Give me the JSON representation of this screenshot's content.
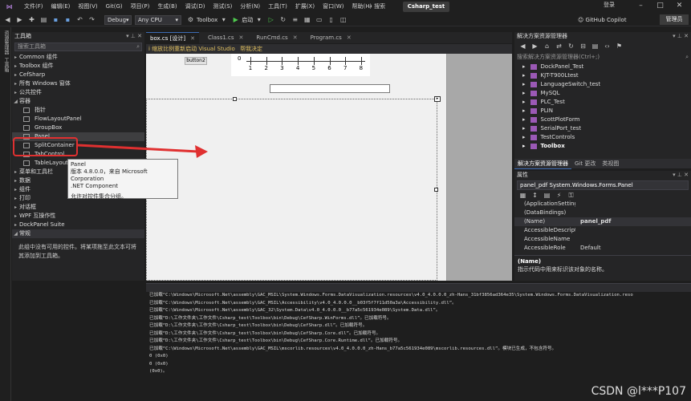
{
  "menu": {
    "items": [
      "文件(F)",
      "编辑(E)",
      "视图(V)",
      "Git(G)",
      "项目(P)",
      "生成(B)",
      "调试(D)",
      "测试(S)",
      "分析(N)",
      "工具(T)",
      "扩展(X)",
      "窗口(W)",
      "帮助(H)"
    ],
    "search_label": "搜索",
    "project_name": "Csharp_test",
    "login_label": "登录"
  },
  "toolbar": {
    "config": "Debug",
    "platform": "Any CPU",
    "toolbox_label": "Toolbox",
    "start_label": "启动",
    "copilot_label": "GitHub Copilot",
    "admin_label": "管理员"
  },
  "left_strip": {
    "tab1": "资源管理器",
    "tab2": "工具箱"
  },
  "toolbox": {
    "title": "工具箱",
    "search_placeholder": "搜索工具箱",
    "items": [
      {
        "label": "Common 组件",
        "arrow": "▸"
      },
      {
        "label": "Toolbox 组件",
        "arrow": "▸"
      },
      {
        "label": "CefSharp",
        "arrow": "▸"
      },
      {
        "label": "所有 Windows 窗体",
        "arrow": "▸"
      },
      {
        "label": "公共控件",
        "arrow": "▸"
      },
      {
        "label": "容器",
        "arrow": "◢"
      }
    ],
    "container_items": [
      "指针",
      "FlowLayoutPanel",
      "GroupBox",
      "Panel",
      "SplitContainer",
      "TabControl",
      "TableLayoutPanel"
    ],
    "items_after": [
      {
        "label": "菜单和工具栏",
        "arrow": "▸"
      },
      {
        "label": "数据",
        "arrow": "▸"
      },
      {
        "label": "组件",
        "arrow": "▸"
      },
      {
        "label": "打印",
        "arrow": "▸"
      },
      {
        "label": "对话框",
        "arrow": "▸"
      },
      {
        "label": "WPF 互操作性",
        "arrow": "▸"
      },
      {
        "label": "DockPanel Suite",
        "arrow": "▸"
      },
      {
        "label": "常规",
        "arrow": "◢"
      }
    ],
    "no_controls_text": "此组中没有可用的控件。将某项拖至此文本可将其添加到工具箱。"
  },
  "tooltip": {
    "title": "Panel",
    "line1": "版本 4.8.0.0，来自 Microsoft Corporation",
    "line2": ".NET Component",
    "line3": "允许对控件集合分组。"
  },
  "editor": {
    "tabs": [
      {
        "label": "box.cs [设计]",
        "active": true
      },
      {
        "label": "Class1.cs",
        "active": false
      },
      {
        "label": "RunCmd.cs",
        "active": false
      },
      {
        "label": "Program.cs",
        "active": false
      }
    ],
    "infobar": "i 缩放比例重新启动 Visual Studio",
    "infobar_link": "帮我决定",
    "button2_label": "button2",
    "scale_zero": "0",
    "scale_labels": [
      "1",
      "2",
      "3",
      "4",
      "5",
      "6",
      "7",
      "8"
    ]
  },
  "solution_explorer": {
    "title": "解决方案资源管理器",
    "search_placeholder": "搜索解决方案资源管理器(Ctrl+;)",
    "items": [
      "DockPanel_Test",
      "KJT-T900Ltest",
      "LanguageSwitch_test",
      "MySQL",
      "PLC_Test",
      "PLIN",
      "ScottPlotForm",
      "SerialPort_test",
      "TestControls",
      "Toolbox"
    ],
    "tabs": [
      "解决方案资源管理器",
      "Git 更改",
      "类视图"
    ]
  },
  "properties": {
    "title": "属性",
    "object": "panel_pdf  System.Windows.Forms.Panel",
    "rows": [
      {
        "name": "(ApplicationSettings)",
        "value": ""
      },
      {
        "name": "(DataBindings)",
        "value": ""
      },
      {
        "name": "(Name)",
        "value": "panel_pdf"
      },
      {
        "name": "AccessibleDescriptor",
        "value": ""
      },
      {
        "name": "AccessibleName",
        "value": ""
      },
      {
        "name": "AccessibleRole",
        "value": "Default"
      }
    ],
    "desc_title": "(Name)",
    "desc_text": "指示代码中用来标识该对象的名称。"
  },
  "output": {
    "lines": [
      "已加载“C:\\Windows\\Microsoft.Net\\assembly\\GAC_MSIL\\System.Windows.Forms.DataVisualization.resources\\v4.0_4.0.0.0_zh-Hans_31bf3856ad364e35\\System.Windows.Forms.DataVisualization.reso",
      "已加载“C:\\Windows\\Microsoft.Net\\assembly\\GAC_MSIL\\Accessibility\\v4.0_4.0.0.0__b03f5f7f11d50a3a\\Accessibility.dll”。",
      "已加载“C:\\Windows\\Microsoft.Net\\assembly\\GAC_32\\System.Data\\v4.0_4.0.0.0__b77a5c561934e089\\System.Data.dll”。",
      "已加载“D:\\工作文件夹\\工作文件\\Csharp_test\\Toolbox\\bin\\Debug\\CefSharp.WinForms.dll”。已加载符号。",
      "已加载“D:\\工作文件夹\\工作文件\\Csharp_test\\Toolbox\\bin\\Debug\\CefSharp.dll”。已加载符号。",
      "已加载“D:\\工作文件夹\\工作文件\\Csharp_test\\Toolbox\\bin\\Debug\\CefSharp.Core.dll”。已加载符号。",
      "已加载“D:\\工作文件夹\\工作文件\\Csharp_test\\Toolbox\\bin\\Debug\\CefSharp.Core.Runtime.dll”。已加载符号。",
      "已加载“C:\\Windows\\Microsoft.Net\\assembly\\GAC_MSIL\\mscorlib.resources\\v4.0_4.0.0.0_zh-Hans_b77a5c561934e089\\mscorlib.resources.dll”。模块已生成，不包含符号。",
      "0 (0x0)",
      "0 (0x0)",
      "(0x0)。"
    ]
  },
  "watermark": "CSDN @l***P107",
  "colors": {
    "accent": "#3d6bb3",
    "annotation": "#e03030"
  }
}
